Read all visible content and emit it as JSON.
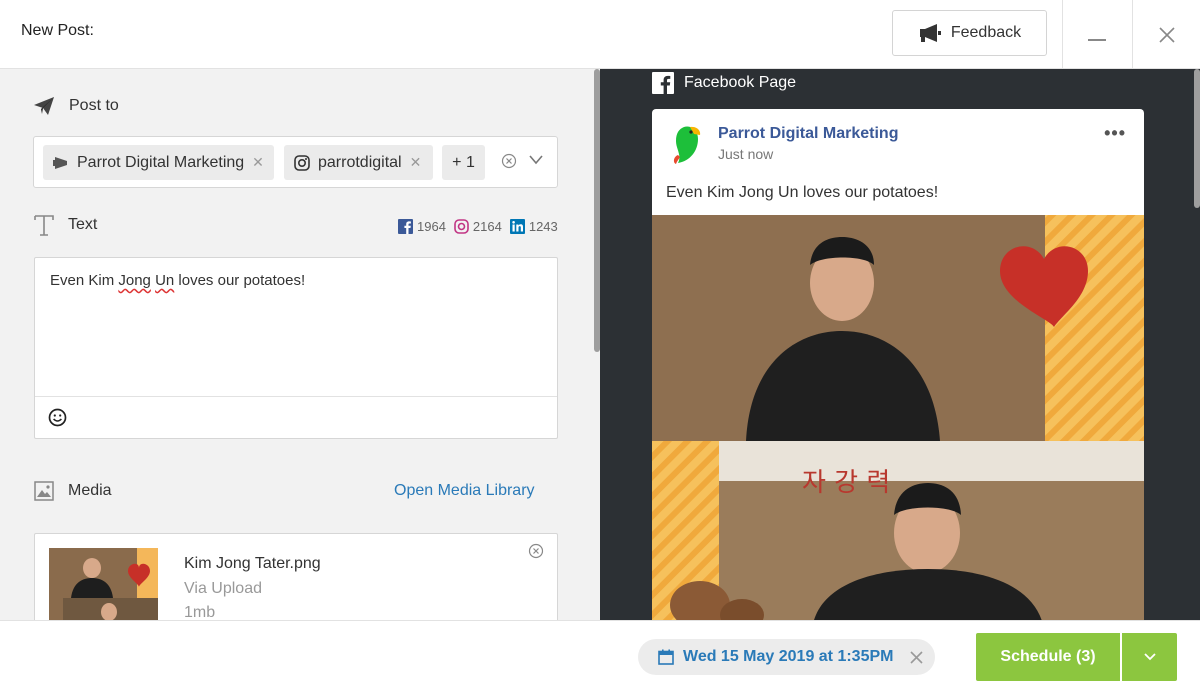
{
  "header": {
    "title": "New Post:",
    "feedback_label": "Feedback",
    "minimize_icon": "minimize-icon",
    "close_icon": "close-icon"
  },
  "composer": {
    "post_to_label": "Post to",
    "recipients": [
      {
        "label": "Parrot Digital Marketing",
        "icon": "megaphone-icon"
      },
      {
        "label": "parrotdigital",
        "icon": "instagram-icon"
      }
    ],
    "more_recipients": "+ 1",
    "text_label": "Text",
    "char_counts": {
      "facebook": "1964",
      "instagram": "2164",
      "linkedin": "1243"
    },
    "post_text_before": "Even Kim ",
    "post_text_w1": "Jong",
    "post_text_sp": " ",
    "post_text_w2": "Un",
    "post_text_after": " loves our potatoes!",
    "media_label": "Media",
    "open_media_library": "Open Media Library",
    "media_item": {
      "name": "Kim Jong Tater.png",
      "via": "Via Upload",
      "size": "1mb"
    }
  },
  "preview": {
    "network_label": "Facebook Page",
    "page_name": "Parrot Digital Marketing",
    "time": "Just now",
    "more": "•••",
    "post_text": "Even Kim Jong Un loves our potatoes!"
  },
  "footer": {
    "date": "Wed 15 May 2019 at 1:35PM",
    "schedule_label": "Schedule (3)"
  },
  "colors": {
    "accent_green": "#8cc63f",
    "link_blue": "#2a7ab8",
    "facebook_blue": "#3b5998",
    "dark_panel": "#2c3034"
  }
}
